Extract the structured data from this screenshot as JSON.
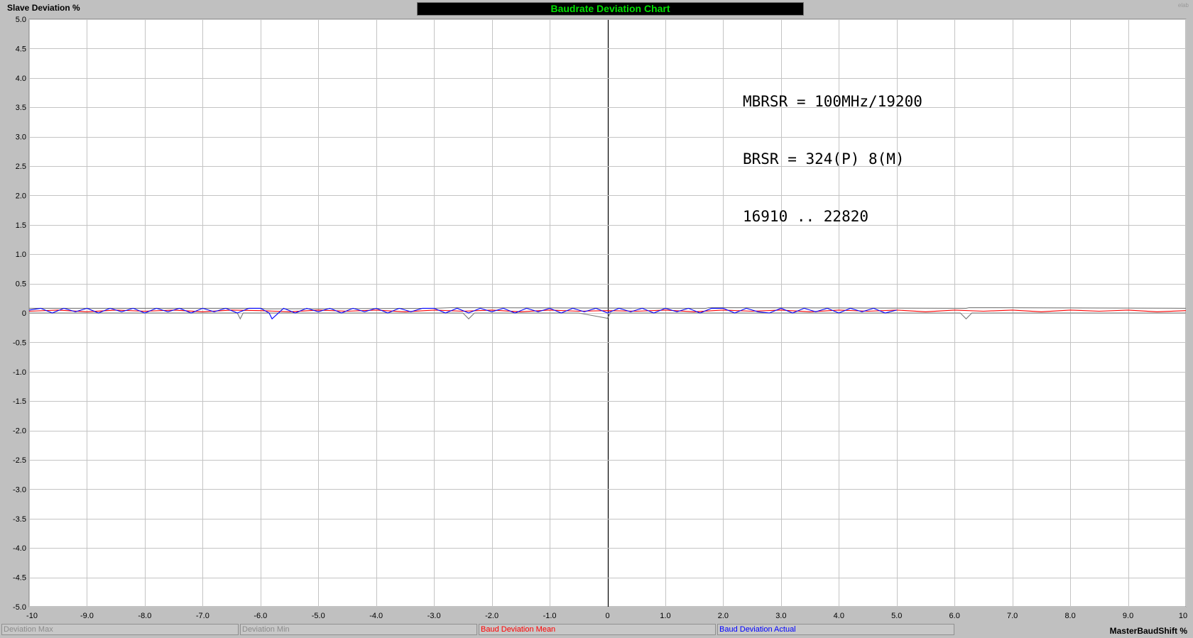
{
  "chart_data": {
    "type": "line",
    "title": "Baudrate Deviation Chart",
    "ylabel": "Slave Deviation %",
    "xlabel": "MasterBaudShift %",
    "xlim": [
      -10,
      10
    ],
    "ylim": [
      -5,
      5
    ],
    "xticks": [
      "-10",
      "-9.0",
      "-8.0",
      "-7.0",
      "-6.0",
      "-5.0",
      "-4.0",
      "-3.0",
      "-2.0",
      "-1.0",
      "0",
      "1.0",
      "2.0",
      "3.0",
      "4.0",
      "5.0",
      "6.0",
      "7.0",
      "8.0",
      "9.0",
      "10"
    ],
    "yticks": [
      "5.0",
      "4.5",
      "4.0",
      "3.5",
      "3.0",
      "2.5",
      "2.0",
      "1.5",
      "1.0",
      "0.5",
      "0",
      "-0.5",
      "-1.0",
      "-1.5",
      "-2.0",
      "-2.5",
      "-3.0",
      "-3.5",
      "-4.0",
      "-4.5",
      "-5.0"
    ],
    "grid": true,
    "legend_position": "bottom",
    "annotations": [
      "MBRSR = 100MHz/19200",
      "BRSR = 324(P) 8(M)",
      "16910 .. 22820"
    ],
    "series": [
      {
        "name": "Deviation Max",
        "color": "#7a7a7a",
        "x": [
          -10,
          -6.0,
          -5.9,
          -3.0,
          -2.7,
          1.7,
          1.75,
          6.2,
          6.25,
          10
        ],
        "y": [
          0.08,
          0.08,
          0.07,
          0.08,
          0.09,
          0.08,
          0.09,
          0.08,
          0.09,
          0.08
        ]
      },
      {
        "name": "Deviation Min",
        "color": "#7a7a7a",
        "x": [
          -10,
          -6.4,
          -6.35,
          -6.3,
          -2.5,
          -2.4,
          -2.3,
          -0.5,
          0,
          0.05,
          6.1,
          6.2,
          6.3,
          10
        ],
        "y": [
          0,
          0,
          -0.1,
          0,
          0,
          -0.1,
          0,
          0,
          -0.09,
          0,
          0,
          -0.1,
          0,
          0
        ]
      },
      {
        "name": "Baud Deviation Mean",
        "color": "#ff0000",
        "x": [
          -10,
          -9.5,
          -9,
          -8.5,
          -8,
          -7.5,
          -7,
          -6.5,
          -6,
          -5.5,
          -5,
          -4.5,
          -4,
          -3.5,
          -3,
          -2.5,
          -2,
          -1.5,
          -1,
          -0.5,
          0,
          0.5,
          1,
          1.5,
          2,
          2.5,
          3,
          3.5,
          4,
          4.5,
          5,
          5.5,
          6,
          6.5,
          7,
          7.5,
          8,
          8.5,
          9,
          9.5,
          10
        ],
        "y": [
          0.03,
          0.05,
          0.02,
          0.05,
          0.03,
          0.05,
          0.02,
          0.05,
          0.04,
          0.02,
          0.05,
          0.03,
          0.05,
          0.02,
          0.05,
          0.03,
          0.05,
          0.02,
          0.05,
          0.03,
          0.04,
          0.03,
          0.05,
          0.02,
          0.05,
          0.03,
          0.05,
          0.02,
          0.05,
          0.03,
          0.05,
          0.02,
          0.05,
          0.03,
          0.05,
          0.02,
          0.05,
          0.03,
          0.05,
          0.02,
          0.04
        ]
      },
      {
        "name": "Baud Deviation Actual",
        "color": "#0000ff",
        "x": [
          -10,
          -9.8,
          -9.6,
          -9.4,
          -9.2,
          -9.0,
          -8.8,
          -8.6,
          -8.4,
          -8.2,
          -8.0,
          -7.8,
          -7.6,
          -7.4,
          -7.2,
          -7.0,
          -6.8,
          -6.6,
          -6.4,
          -6.2,
          -6.0,
          -5.85,
          -5.8,
          -5.6,
          -5.4,
          -5.2,
          -5.0,
          -4.8,
          -4.6,
          -4.4,
          -4.2,
          -4.0,
          -3.8,
          -3.6,
          -3.4,
          -3.2,
          -3.0,
          -2.8,
          -2.6,
          -2.4,
          -2.2,
          -2.0,
          -1.8,
          -1.6,
          -1.4,
          -1.2,
          -1.0,
          -0.8,
          -0.6,
          -0.4,
          -0.2,
          0,
          0.2,
          0.4,
          0.6,
          0.8,
          1.0,
          1.2,
          1.4,
          1.6,
          1.8,
          2.0,
          2.2,
          2.4,
          2.6,
          2.8,
          3.0,
          3.2,
          3.4,
          3.6,
          3.8,
          4.0,
          4.2,
          4.4,
          4.6,
          4.8,
          5.0
        ],
        "y": [
          0.05,
          0.08,
          0.0,
          0.08,
          0.02,
          0.08,
          0.0,
          0.08,
          0.02,
          0.08,
          0.0,
          0.08,
          0.02,
          0.08,
          0.0,
          0.08,
          0.02,
          0.08,
          0.0,
          0.08,
          0.08,
          0.0,
          -0.1,
          0.08,
          0.0,
          0.08,
          0.02,
          0.08,
          0.0,
          0.08,
          0.02,
          0.08,
          0.0,
          0.08,
          0.02,
          0.08,
          0.08,
          0.0,
          0.08,
          0.0,
          0.08,
          0.02,
          0.08,
          0.0,
          0.08,
          0.02,
          0.08,
          0.0,
          0.08,
          0.02,
          0.08,
          0.0,
          0.08,
          0.02,
          0.08,
          0.0,
          0.08,
          0.02,
          0.08,
          0.0,
          0.08,
          0.08,
          0.0,
          0.08,
          0.02,
          0.0,
          0.08,
          0.0,
          0.08,
          0.02,
          0.08,
          0.0,
          0.08,
          0.02,
          0.08,
          0.0,
          0.05
        ]
      }
    ]
  },
  "legend": {
    "max_label": "Deviation Max",
    "min_label": "Deviation Min",
    "mean_label": "Baud Deviation Mean",
    "actual_label": "Baud Deviation Actual"
  },
  "watermark": "elab"
}
